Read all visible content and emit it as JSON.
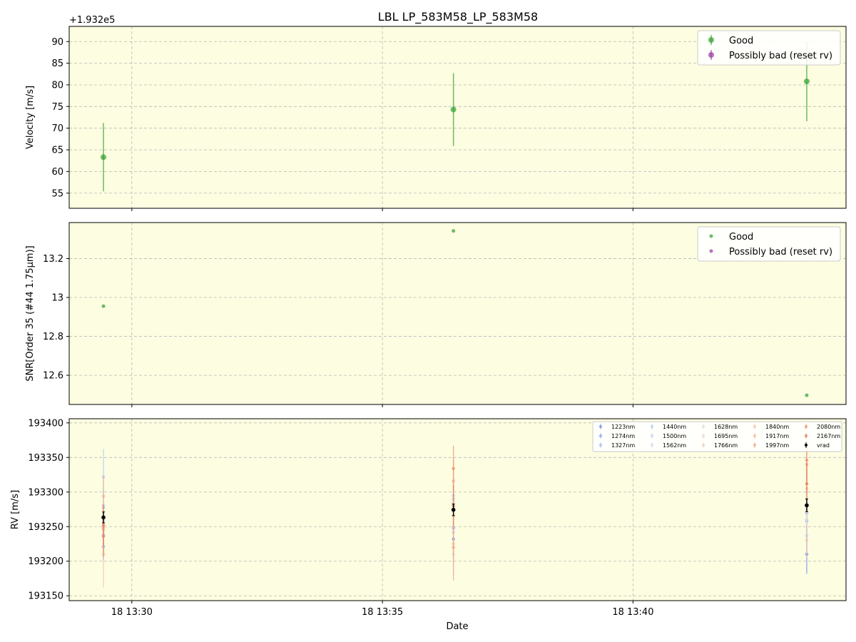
{
  "figure": {
    "title": "LBL LP_583M58_LP_583M58",
    "xlabel": "Date",
    "xticks": [
      {
        "t": 29.85,
        "label": "18 13:30"
      },
      {
        "t": 34.85,
        "label": "18 13:35"
      },
      {
        "t": 39.85,
        "label": "18 13:40"
      }
    ],
    "times": [
      29.29,
      36.26,
      43.32
    ]
  },
  "chart_data": [
    {
      "type": "scatter",
      "panel": "velocity",
      "ylabel": "Velocity [m/s]",
      "offset_label": "+1.932e5",
      "ylim": [
        51.5,
        93.5
      ],
      "yticks": [
        55,
        60,
        65,
        70,
        75,
        80,
        85,
        90
      ],
      "grid": true,
      "legend": {
        "placement": "top-right",
        "entries": [
          "Good",
          "Possibly bad (reset rv)"
        ]
      },
      "series": [
        {
          "name": "Good",
          "color": "#2ca02c",
          "points": [
            {
              "x": "18 13:29:17",
              "y": 63.3,
              "err": 7.9
            },
            {
              "x": "18 13:36:16",
              "y": 74.3,
              "err": 8.4
            },
            {
              "x": "18 13:43:19",
              "y": 80.8,
              "err": 9.2
            }
          ]
        },
        {
          "name": "Possibly bad (reset rv)",
          "color": "#9b30a8",
          "points": []
        }
      ]
    },
    {
      "type": "scatter",
      "panel": "snr",
      "ylabel": "SNR[Order 35 (#44 1.75μm)]",
      "ylim": [
        12.45,
        13.385
      ],
      "yticks": [
        12.6,
        12.8,
        13.0,
        13.2
      ],
      "grid": true,
      "legend": {
        "placement": "top-right",
        "entries": [
          "Good",
          "Possibly bad (reset rv)"
        ]
      },
      "series": [
        {
          "name": "Good",
          "color": "#2ca02c",
          "points": [
            {
              "x": "18 13:29:17",
              "y": 12.955
            },
            {
              "x": "18 13:36:16",
              "y": 13.342
            },
            {
              "x": "18 13:43:19",
              "y": 12.497
            }
          ]
        },
        {
          "name": "Possibly bad (reset rv)",
          "color": "#9b30a8",
          "points": []
        }
      ]
    },
    {
      "type": "scatter",
      "panel": "rv",
      "ylabel": "RV [m/s]",
      "ylim": [
        193143,
        193406
      ],
      "yticks": [
        193150,
        193200,
        193250,
        193300,
        193350,
        193400
      ],
      "grid": true,
      "legend": {
        "placement": "top-right"
      },
      "series": [
        {
          "name": "1223nm",
          "color": "#6f8ff0",
          "points": [
            {
              "x": "18 13:29:17",
              "y": 193237,
              "err": 30
            },
            {
              "x": "18 13:36:16",
              "y": 193232,
              "err": 25
            },
            {
              "x": "18 13:43:19",
              "y": 193210,
              "err": 28
            }
          ]
        },
        {
          "name": "1274nm",
          "color": "#86a4f5",
          "points": [
            {
              "x": "18 13:29:17",
              "y": 193221,
              "err": 20
            },
            {
              "x": "18 13:36:16",
              "y": 193248,
              "err": 22
            },
            {
              "x": "18 13:43:19",
              "y": 193258,
              "err": 25
            }
          ]
        },
        {
          "name": "1327nm",
          "color": "#9cb8f8",
          "points": [
            {
              "x": "18 13:29:17",
              "y": 193278,
              "err": 25
            },
            {
              "x": "18 13:36:16",
              "y": 193290,
              "err": 20
            },
            {
              "x": "18 13:43:19",
              "y": 193269,
              "err": 30
            }
          ]
        },
        {
          "name": "1440nm",
          "color": "#b2c8f8",
          "points": [
            {
              "x": "18 13:29:17",
              "y": 193322,
              "err": 40
            },
            {
              "x": "18 13:36:16",
              "y": 193295,
              "err": 20
            },
            {
              "x": "18 13:43:19",
              "y": 193237,
              "err": 25
            }
          ]
        },
        {
          "name": "1500nm",
          "color": "#c4d4f5",
          "points": [
            {
              "x": "18 13:29:17",
              "y": 193281,
              "err": 30
            },
            {
              "x": "18 13:36:16",
              "y": 193242,
              "err": 25
            },
            {
              "x": "18 13:43:19",
              "y": 193270,
              "err": 20
            }
          ]
        },
        {
          "name": "1562nm",
          "color": "#d2dcf0",
          "points": [
            {
              "x": "18 13:29:17",
              "y": 193258,
              "err": 30
            },
            {
              "x": "18 13:36:16",
              "y": 193285,
              "err": 30
            },
            {
              "x": "18 13:43:19",
              "y": 193260,
              "err": 25
            }
          ]
        },
        {
          "name": "1628nm",
          "color": "#dcdcdc",
          "points": [
            {
              "x": "18 13:29:17",
              "y": 193250,
              "err": 35
            },
            {
              "x": "18 13:36:16",
              "y": 193210,
              "err": 30
            },
            {
              "x": "18 13:43:19",
              "y": 193280,
              "err": 25
            }
          ]
        },
        {
          "name": "1695nm",
          "color": "#e6d8cc",
          "points": [
            {
              "x": "18 13:29:17",
              "y": 193240,
              "err": 30
            },
            {
              "x": "18 13:36:16",
              "y": 193290,
              "err": 30
            },
            {
              "x": "18 13:43:19",
              "y": 193275,
              "err": 25
            }
          ]
        },
        {
          "name": "1766nm",
          "color": "#eecfbd",
          "points": [
            {
              "x": "18 13:29:17",
              "y": 193245,
              "err": 30
            },
            {
              "x": "18 13:36:16",
              "y": 193265,
              "err": 30
            },
            {
              "x": "18 13:43:19",
              "y": 193300,
              "err": 30
            }
          ]
        },
        {
          "name": "1840nm",
          "color": "#f4c4a8",
          "points": [
            {
              "x": "18 13:29:17",
              "y": 193210,
              "err": 48
            },
            {
              "x": "18 13:36:16",
              "y": 193225,
              "err": 30
            },
            {
              "x": "18 13:43:19",
              "y": 193230,
              "err": 25
            }
          ]
        },
        {
          "name": "1917nm",
          "color": "#f5b597",
          "points": [
            {
              "x": "18 13:29:17",
              "y": 193294,
              "err": 30
            },
            {
              "x": "18 13:36:16",
              "y": 193316,
              "err": 30
            },
            {
              "x": "18 13:43:19",
              "y": 193305,
              "err": 30
            }
          ]
        },
        {
          "name": "1997nm",
          "color": "#f2a385",
          "points": [
            {
              "x": "18 13:29:17",
              "y": 193248,
              "err": 35
            },
            {
              "x": "18 13:36:16",
              "y": 193220,
              "err": 48
            },
            {
              "x": "18 13:43:19",
              "y": 193340,
              "err": 30
            }
          ]
        },
        {
          "name": "2080nm",
          "color": "#ec8f6e",
          "points": [
            {
              "x": "18 13:29:17",
              "y": 193236,
              "err": 30
            },
            {
              "x": "18 13:36:16",
              "y": 193334,
              "err": 33
            },
            {
              "x": "18 13:43:19",
              "y": 193346,
              "err": 30
            }
          ]
        },
        {
          "name": "2167nm",
          "color": "#e27a5a",
          "points": [
            {
              "x": "18 13:29:17",
              "y": 193252,
              "err": 30
            },
            {
              "x": "18 13:36:16",
              "y": 193280,
              "err": 30
            },
            {
              "x": "18 13:43:19",
              "y": 193312,
              "err": 30
            }
          ]
        },
        {
          "name": "vrad",
          "color": "#000000",
          "points": [
            {
              "x": "18 13:29:17",
              "y": 193263.3,
              "err": 7.9
            },
            {
              "x": "18 13:36:16",
              "y": 193274.3,
              "err": 8.4
            },
            {
              "x": "18 13:43:19",
              "y": 193280.8,
              "err": 9.2
            }
          ]
        }
      ]
    }
  ]
}
